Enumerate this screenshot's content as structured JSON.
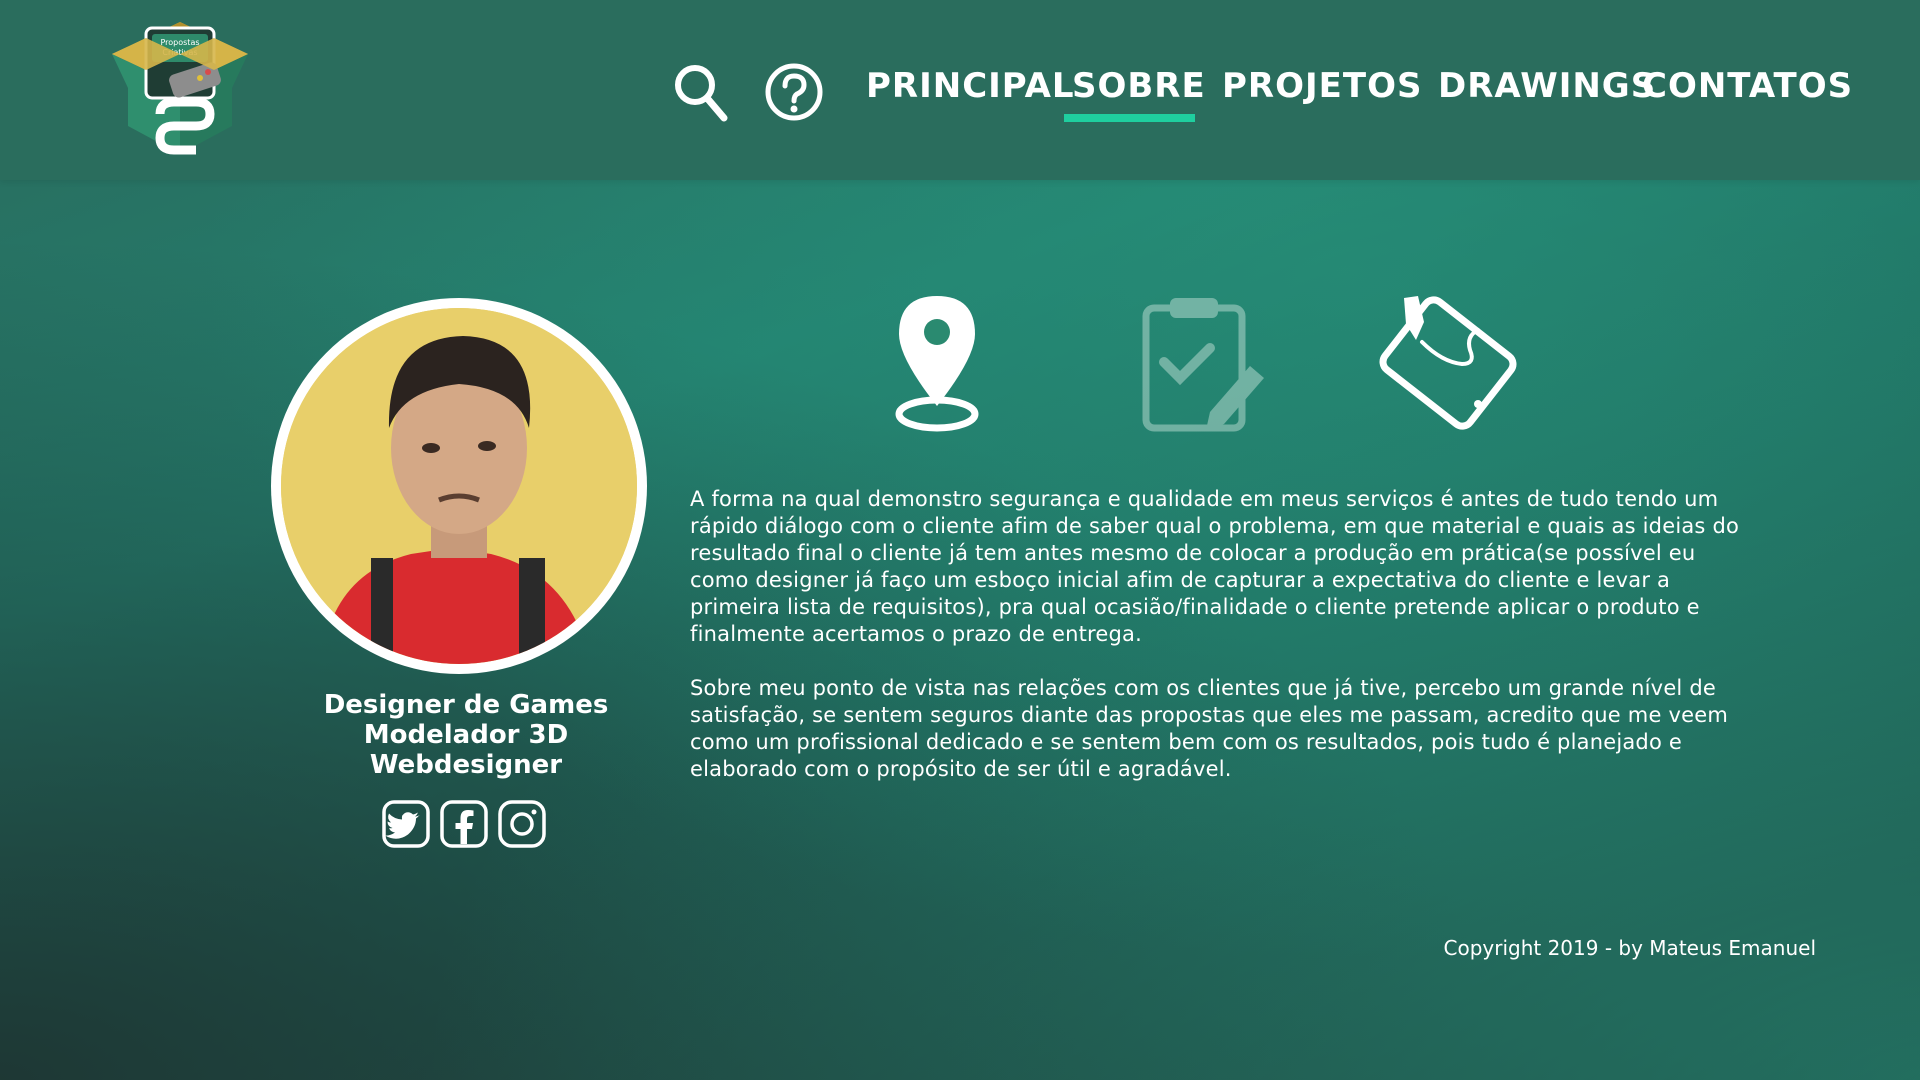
{
  "logo": {
    "text_line1": "Propostas",
    "text_line2": "Criativas"
  },
  "nav": {
    "search_icon": "search-icon",
    "help_icon": "help-icon",
    "items": [
      {
        "label": "PRINCIPAL"
      },
      {
        "label": "SOBRE",
        "active": true
      },
      {
        "label": "PROJETOS"
      },
      {
        "label": "DRAWINGS"
      },
      {
        "label": "CONTATOS"
      }
    ]
  },
  "profile": {
    "roles": [
      "Designer de Games",
      "Modelador 3D",
      "Webdesigner"
    ],
    "socials": [
      "twitter-icon",
      "facebook-icon",
      "instagram-icon"
    ]
  },
  "features": [
    "location-pin-icon",
    "checklist-icon",
    "tablet-pen-icon"
  ],
  "about": {
    "paragraphs": [
      "A forma na qual demonstro segurança e qualidade em meus serviços é antes de tudo tendo um rápido diálogo com o  cliente afim de saber qual o problema, em que material e quais as ideias do resultado final o cliente já tem antes mesmo de colocar a produção em prática(se possível eu como designer já faço um esboço inicial afim de capturar a expectativa do cliente e levar a primeira lista de requisitos), pra qual ocasião/finalidade o cliente pretende aplicar o produto e finalmente acertamos o prazo de entrega.",
      "Sobre meu ponto de vista nas relações com os clientes que já tive, percebo um grande nível de satisfação, se sentem seguros diante das propostas que eles me passam, acredito que me veem como um profissional dedicado e se sentem bem com os resultados, pois tudo é planejado e elaborado com o propósito de ser útil e agradável."
    ]
  },
  "footer": {
    "copyright": "Copyright 2019 - by Mateus Emanuel"
  },
  "colors": {
    "header": "#2a6d5d",
    "accent": "#1fcf9f",
    "logo_gold": "#c9a63a",
    "logo_green": "#2f8f6e"
  }
}
